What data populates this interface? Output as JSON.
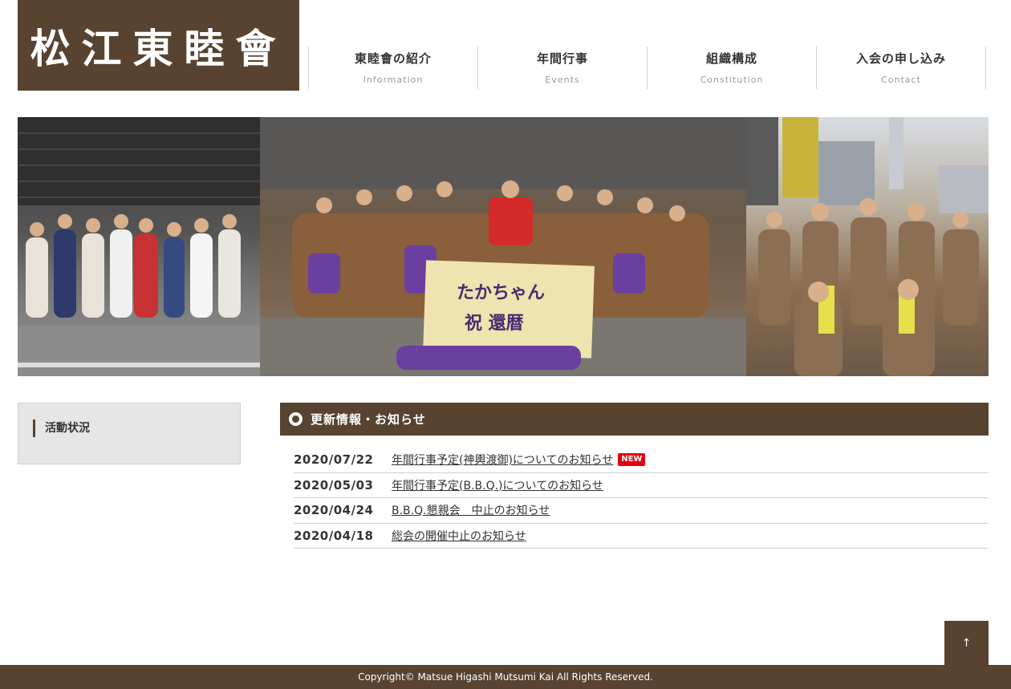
{
  "site": {
    "logo_text": "松江東睦會"
  },
  "nav": {
    "items": [
      {
        "label": "東睦會の紹介",
        "sublabel": "Information"
      },
      {
        "label": "年間行事",
        "sublabel": "Events"
      },
      {
        "label": "組織構成",
        "sublabel": "Constitution"
      },
      {
        "label": "入会の申し込み",
        "sublabel": "Contact"
      }
    ]
  },
  "hero": {
    "banner_line1": "たかちゃん",
    "banner_line2": "祝 還暦"
  },
  "sidebar": {
    "title": "活動状況"
  },
  "news": {
    "heading": "更新情報・お知らせ",
    "items": [
      {
        "date": "2020/07/22",
        "title": "年間行事予定(神輿渡御)についてのお知らせ",
        "badge": "NEW"
      },
      {
        "date": "2020/05/03",
        "title": "年間行事予定(B.B.Q.)についてのお知らせ"
      },
      {
        "date": "2020/04/24",
        "title": "B.B.Q.懇親会　中止のお知らせ"
      },
      {
        "date": "2020/04/18",
        "title": "総会の開催中止のお知らせ"
      }
    ]
  },
  "back_to_top": {
    "label": "↑"
  },
  "footer": {
    "copyright": "Copyright© Matsue Higashi Mutsumi Kai All Rights Reserved."
  },
  "colors": {
    "brand": "#574330",
    "badge": "#e60012"
  }
}
